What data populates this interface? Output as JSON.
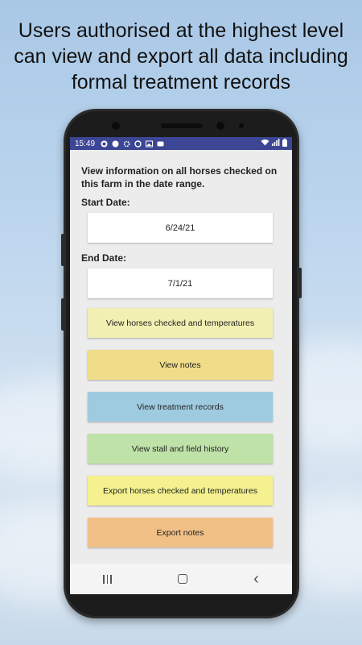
{
  "headline": "Users authorised at the highest level can view and export all data including formal treatment records",
  "status_bar": {
    "time": "15:49",
    "left_icons": [
      "app-icon",
      "app-icon",
      "settings-icon",
      "app-icon",
      "image-icon",
      "app-icon"
    ],
    "right_icons": [
      "wifi-icon",
      "signal-icon",
      "battery-icon"
    ]
  },
  "screen": {
    "intro": "View information on all horses checked on this farm in the date range.",
    "start_label": "Start Date:",
    "start_value": "6/24/21",
    "end_label": "End Date:",
    "end_value": "7/1/21",
    "buttons": [
      {
        "label": "View horses checked and temperatures",
        "color": "#f2efb3"
      },
      {
        "label": "View notes",
        "color": "#efdd8a"
      },
      {
        "label": "View treatment records",
        "color": "#9fcbe1"
      },
      {
        "label": "View stall and field history",
        "color": "#bfe2a8"
      },
      {
        "label": "Export horses checked and temperatures",
        "color": "#f4f18e"
      },
      {
        "label": "Export notes",
        "color": "#f1c087"
      }
    ]
  },
  "nav": {
    "back": "‹"
  }
}
